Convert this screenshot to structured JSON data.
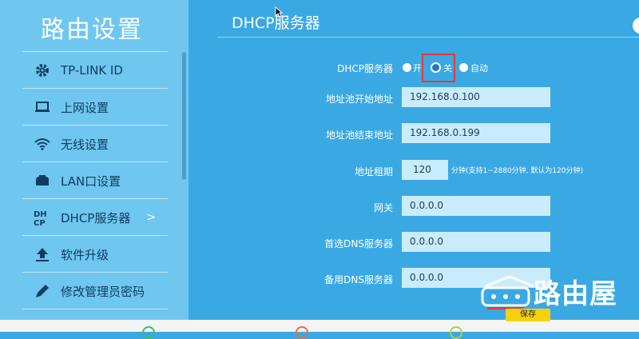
{
  "app_title": "路由设置",
  "sidebar": {
    "items": [
      {
        "label": "TP-LINK ID",
        "icon": "gear-icon"
      },
      {
        "label": "上网设置",
        "icon": "monitor-icon"
      },
      {
        "label": "无线设置",
        "icon": "wifi-icon"
      },
      {
        "label": "LAN口设置",
        "icon": "lan-icon"
      },
      {
        "label": "DHCP服务器",
        "icon": "dhcp-icon",
        "chevron": ">"
      },
      {
        "label": "软件升级",
        "icon": "upload-icon"
      },
      {
        "label": "修改管理员密码",
        "icon": "pencil-icon"
      }
    ]
  },
  "main": {
    "title": "DHCP服务器",
    "dhcp_server": {
      "label": "DHCP服务器",
      "options": [
        "开",
        "关",
        "自动"
      ],
      "selected": "关"
    },
    "fields": {
      "pool_start": {
        "label": "地址池开始地址",
        "value": "192.168.0.100"
      },
      "pool_end": {
        "label": "地址池结束地址",
        "value": "192.168.0.199"
      },
      "lease": {
        "label": "地址租期",
        "value": "120",
        "hint": "分钟(支持1~2880分钟, 默认为120分钟)"
      },
      "gateway": {
        "label": "网关",
        "value": "0.0.0.0"
      },
      "dns1": {
        "label": "首选DNS服务器",
        "value": "0.0.0.0"
      },
      "dns2": {
        "label": "备用DNS服务器",
        "value": "0.0.0.0"
      }
    },
    "save_label": "保存"
  },
  "watermark": {
    "text": "路由屋"
  },
  "colors": {
    "sidebar_bg": "#6fc7f0",
    "main_bg": "#3aa9e3",
    "input_bg": "#c9ecfd",
    "save_bg": "#f6d10e",
    "highlight": "#e53935"
  }
}
